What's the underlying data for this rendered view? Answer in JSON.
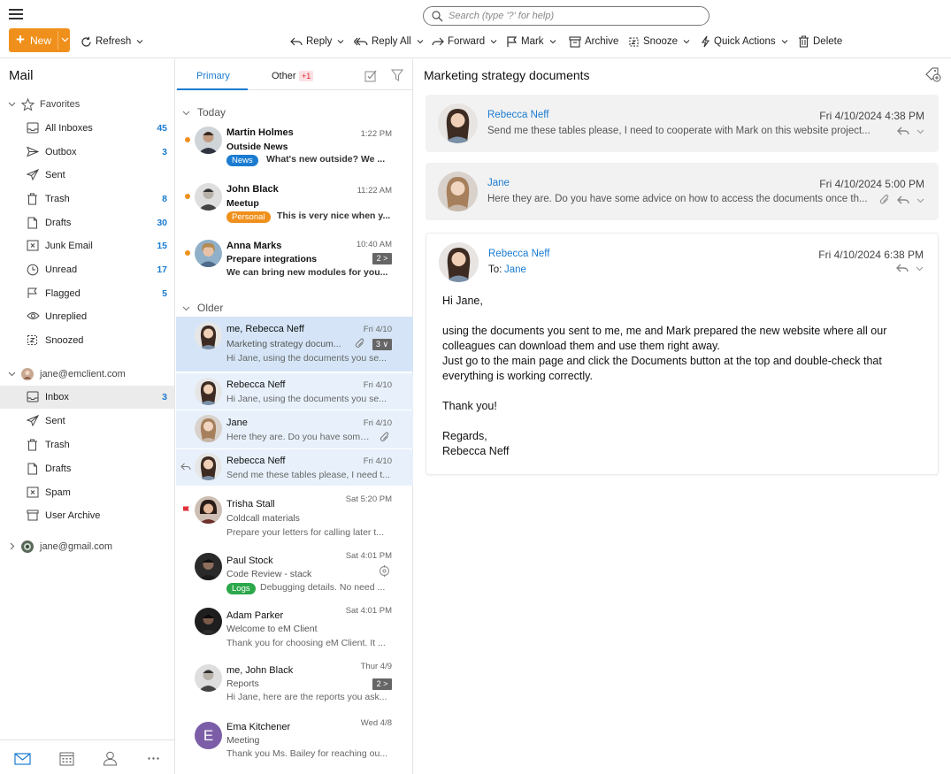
{
  "toolbar": {
    "search_placeholder": "Search (type '?' for help)",
    "new_label": "New",
    "refresh_label": "Refresh",
    "reply_label": "Reply",
    "reply_all_label": "Reply All",
    "forward_label": "Forward",
    "mark_label": "Mark",
    "archive_label": "Archive",
    "snooze_label": "Snooze",
    "quick_actions_label": "Quick Actions",
    "delete_label": "Delete"
  },
  "sidebar": {
    "title": "Mail",
    "favorites": {
      "label": "Favorites",
      "items": [
        {
          "label": "All Inboxes",
          "count": "45"
        },
        {
          "label": "Outbox",
          "count": "3"
        },
        {
          "label": "Sent",
          "count": ""
        },
        {
          "label": "Trash",
          "count": "8"
        },
        {
          "label": "Drafts",
          "count": "30"
        },
        {
          "label": "Junk Email",
          "count": "15"
        },
        {
          "label": "Unread",
          "count": "17"
        },
        {
          "label": "Flagged",
          "count": "5"
        },
        {
          "label": "Unreplied",
          "count": ""
        },
        {
          "label": "Snoozed",
          "count": ""
        }
      ]
    },
    "account1": {
      "label": "jane@emclient.com",
      "items": [
        {
          "label": "Inbox",
          "count": "3"
        },
        {
          "label": "Sent",
          "count": ""
        },
        {
          "label": "Trash",
          "count": ""
        },
        {
          "label": "Drafts",
          "count": ""
        },
        {
          "label": "Spam",
          "count": ""
        },
        {
          "label": "User Archive",
          "count": ""
        }
      ]
    },
    "account2": {
      "label": "jane@gmail.com"
    }
  },
  "list": {
    "tabs": {
      "primary": "Primary",
      "other": "Other",
      "other_badge": "+1"
    },
    "section_today": "Today",
    "section_older": "Older",
    "messages": [
      {
        "from": "Martin Holmes",
        "time": "1:22 PM",
        "subject": "Outside News",
        "tag": "News",
        "tag_color": "#1a7bd1",
        "preview": "What's new outside? We ..."
      },
      {
        "from": "John Black",
        "time": "11:22 AM",
        "subject": "Meetup",
        "tag": "Personal",
        "tag_color": "#f0901c",
        "preview": "This is very nice when y..."
      },
      {
        "from": "Anna Marks",
        "time": "10:40 AM",
        "subject": "Prepare integrations",
        "count": "2 >",
        "preview": "We can bring new modules for you..."
      },
      {
        "from": "me, Rebecca Neff",
        "time": "Fri 4/10",
        "subject": "Marketing strategy docum...",
        "count": "3 ∨",
        "preview": "Hi Jane, using the documents you se..."
      },
      {
        "from": "Rebecca Neff",
        "time": "Fri 4/10",
        "preview": "Hi Jane, using the documents you se..."
      },
      {
        "from": "Jane",
        "time": "Fri 4/10",
        "preview": "Here they are. Do you have some..."
      },
      {
        "from": "Rebecca Neff",
        "time": "Fri 4/10",
        "preview": "Send me these tables please, I need t..."
      },
      {
        "from": "Trisha Stall",
        "time": "Sat 5:20 PM",
        "subject": "Coldcall materials",
        "preview": "Prepare your letters for calling later t..."
      },
      {
        "from": "Paul Stock",
        "time": "Sat 4:01 PM",
        "subject": "Code Review - stack",
        "tag": "Logs",
        "tag_color": "#2ba84a",
        "preview": "Debugging details. No need ..."
      },
      {
        "from": "Adam Parker",
        "time": "Sat 4:01 PM",
        "subject": "Welcome to eM Client",
        "preview": "Thank you for choosing eM Client. It ..."
      },
      {
        "from": "me, John Black",
        "time": "Thur 4/9",
        "subject": "Reports",
        "count": "2 >",
        "preview": "Hi Jane, here are the reports you ask..."
      },
      {
        "from": "Ema Kitchener",
        "time": "Wed 4/8",
        "subject": "Meeting",
        "initial": "E",
        "preview": "Thank you Ms. Bailey for reaching ou..."
      }
    ]
  },
  "reader": {
    "subject": "Marketing strategy documents",
    "cards": [
      {
        "name": "Rebecca Neff",
        "date": "Fri 4/10/2024 4:38 PM",
        "preview": "Send me these tables please, I need to cooperate with Mark on this website project..."
      },
      {
        "name": "Jane",
        "date": "Fri 4/10/2024 5:00 PM",
        "preview": "Here they are. Do you have some advice on how to access the documents once th..."
      },
      {
        "name": "Rebecca Neff",
        "date": "Fri 4/10/2024 6:38 PM",
        "to_label": "To:",
        "to": "Jane"
      }
    ],
    "body": {
      "greeting": "Hi Jane,",
      "p1": "using the documents you sent to me, me and Mark prepared the new website where all our colleagues can download them and use them right away.",
      "p2": "Just go to the main page and click the Documents button at the top and double-check that everything is working correctly.",
      "thanks": "Thank you!",
      "regards": "Regards,",
      "signature": "Rebecca Neff"
    }
  },
  "colors": {
    "accent": "#1a7bd1",
    "new_button": "#f0901c",
    "unread_dot": "#f0901c",
    "flag": "#e0313a"
  }
}
